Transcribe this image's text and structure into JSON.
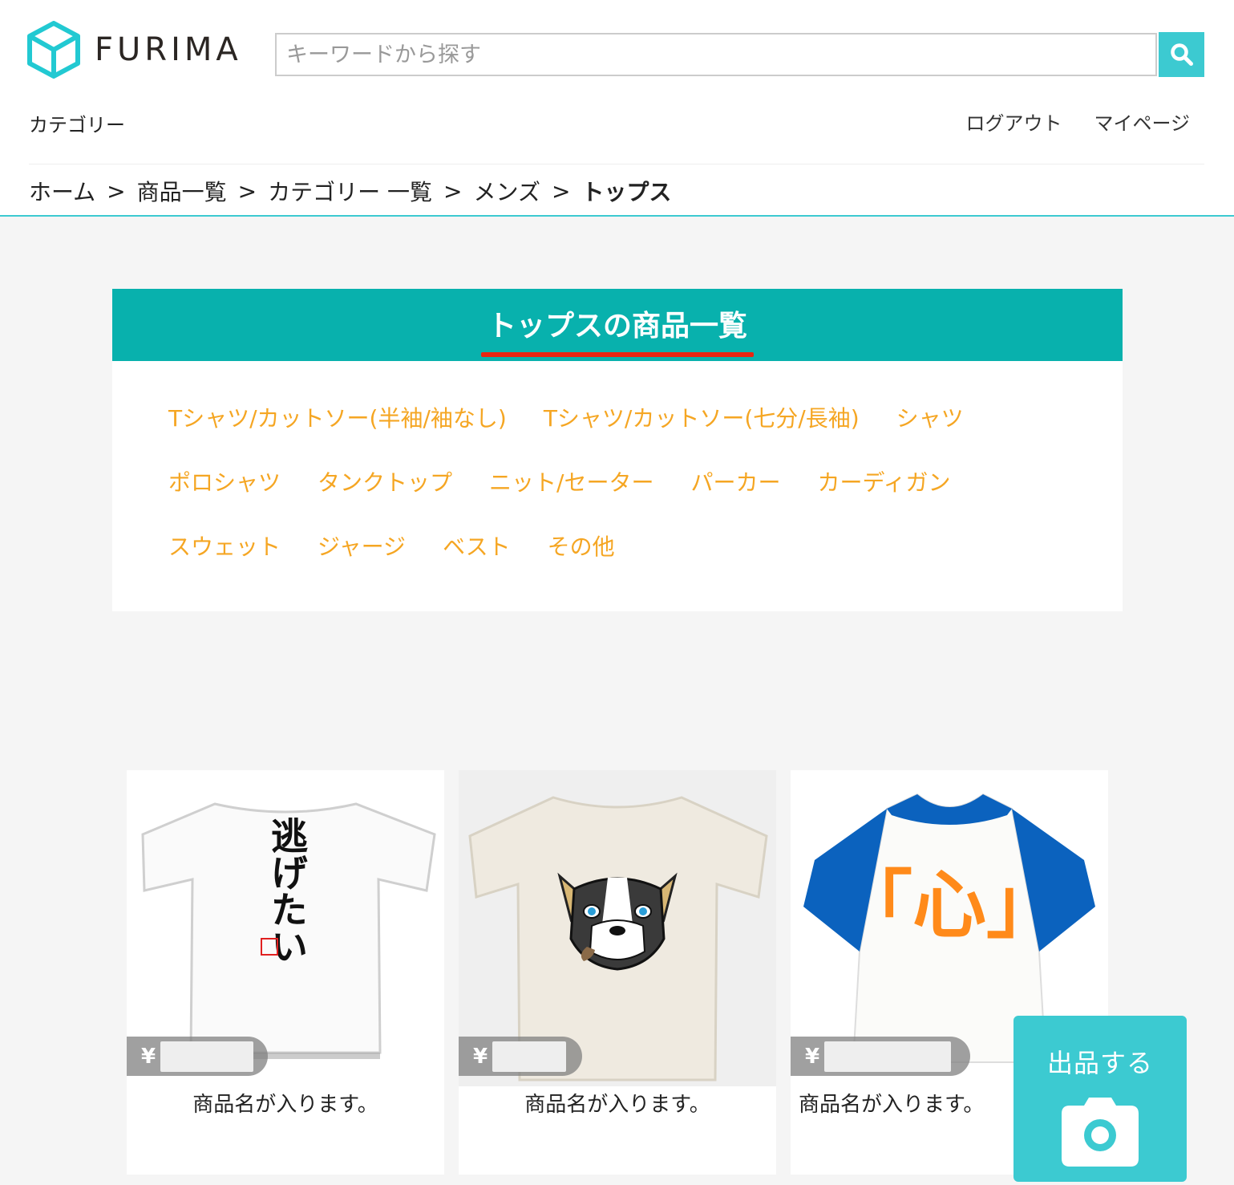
{
  "header": {
    "logo_text": "FURIMA",
    "search_placeholder": "キーワードから探す",
    "category_link": "カテゴリー",
    "logout_link": "ログアウト",
    "mypage_link": "マイページ"
  },
  "breadcrumb": {
    "items": [
      "ホーム",
      "商品一覧",
      "カテゴリー 一覧",
      "メンズ"
    ],
    "separator": ">",
    "current": "トップス"
  },
  "category": {
    "title": "トップスの商品一覧",
    "rows": [
      [
        "Tシャツ/カットソー(半袖/袖なし)",
        "Tシャツ/カットソー(七分/長袖)",
        "シャツ"
      ],
      [
        "ポロシャツ",
        "タンクトップ",
        "ニット/セーター",
        "パーカー",
        "カーディガン"
      ],
      [
        "スウェット",
        "ジャージ",
        "ベスト",
        "その他"
      ]
    ]
  },
  "products": [
    {
      "currency": "¥",
      "name": "商品名が入ります。",
      "print_text": "逃げたい"
    },
    {
      "currency": "¥",
      "name": "商品名が入ります。"
    },
    {
      "currency": "¥",
      "name": "商品名が入ります。",
      "print_text": "「心」"
    }
  ],
  "sell_button": {
    "label": "出品する",
    "icon": "camera-icon"
  },
  "colors": {
    "accent": "#3ccad1",
    "category_bar": "#08b1ad",
    "underline": "#e92511",
    "subcategory": "#f5a623",
    "raglan_sleeve": "#0b62be",
    "print_orange": "#ff8a1a"
  }
}
